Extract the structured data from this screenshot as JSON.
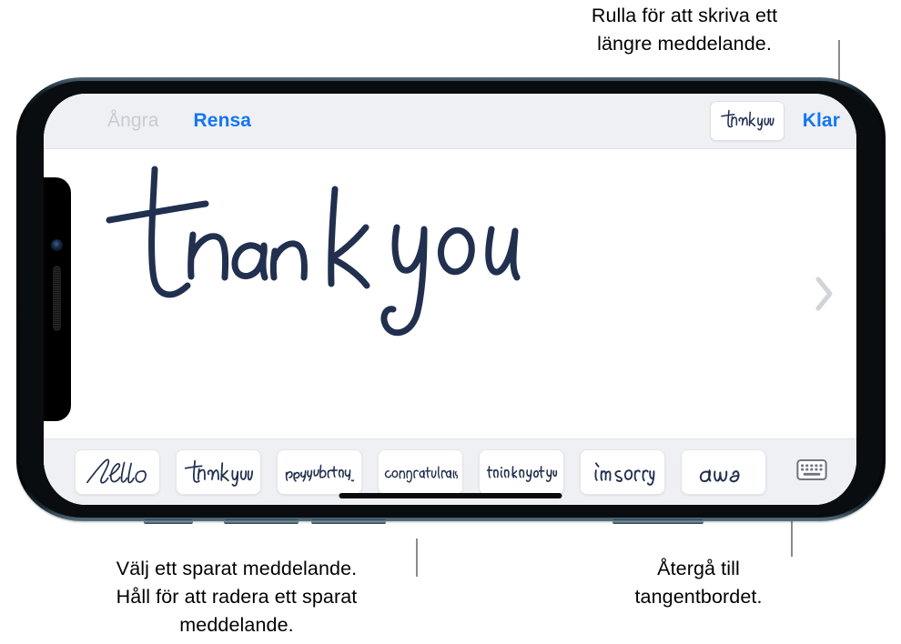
{
  "annotations": {
    "scroll_hint": "Rulla för att skriva ett\nlängre meddelande.",
    "saved_hint": "Välj ett sparat meddelande.\nHåll för att radera ett sparat\nmeddelande.",
    "keyboard_hint": "Återgå till\ntangentbordet."
  },
  "phone": {
    "toolbar": {
      "undo_label": "Ångra",
      "undo_enabled": false,
      "clear_label": "Rensa",
      "done_label": "Klar",
      "thumbnail_text": "thank you"
    },
    "canvas": {
      "handwriting_text": "thank you",
      "ink_color": "#22304f",
      "next_icon": "chevron-right-icon"
    },
    "saved_messages": {
      "items": [
        {
          "text": "hello"
        },
        {
          "text": "thank you"
        },
        {
          "text": "happy birthday."
        },
        {
          "text": "congratulations"
        },
        {
          "text": "thinking of you"
        },
        {
          "text": "i'm sorry"
        },
        {
          "text": "awe"
        }
      ],
      "keyboard_button_icon": "keyboard-icon"
    }
  },
  "colors": {
    "accent_blue": "#1277f1",
    "disabled_gray": "#c9cbd4",
    "chrome_bg": "#eff0f4",
    "ink": "#22304f",
    "leader_line": "#8b8b8b"
  }
}
